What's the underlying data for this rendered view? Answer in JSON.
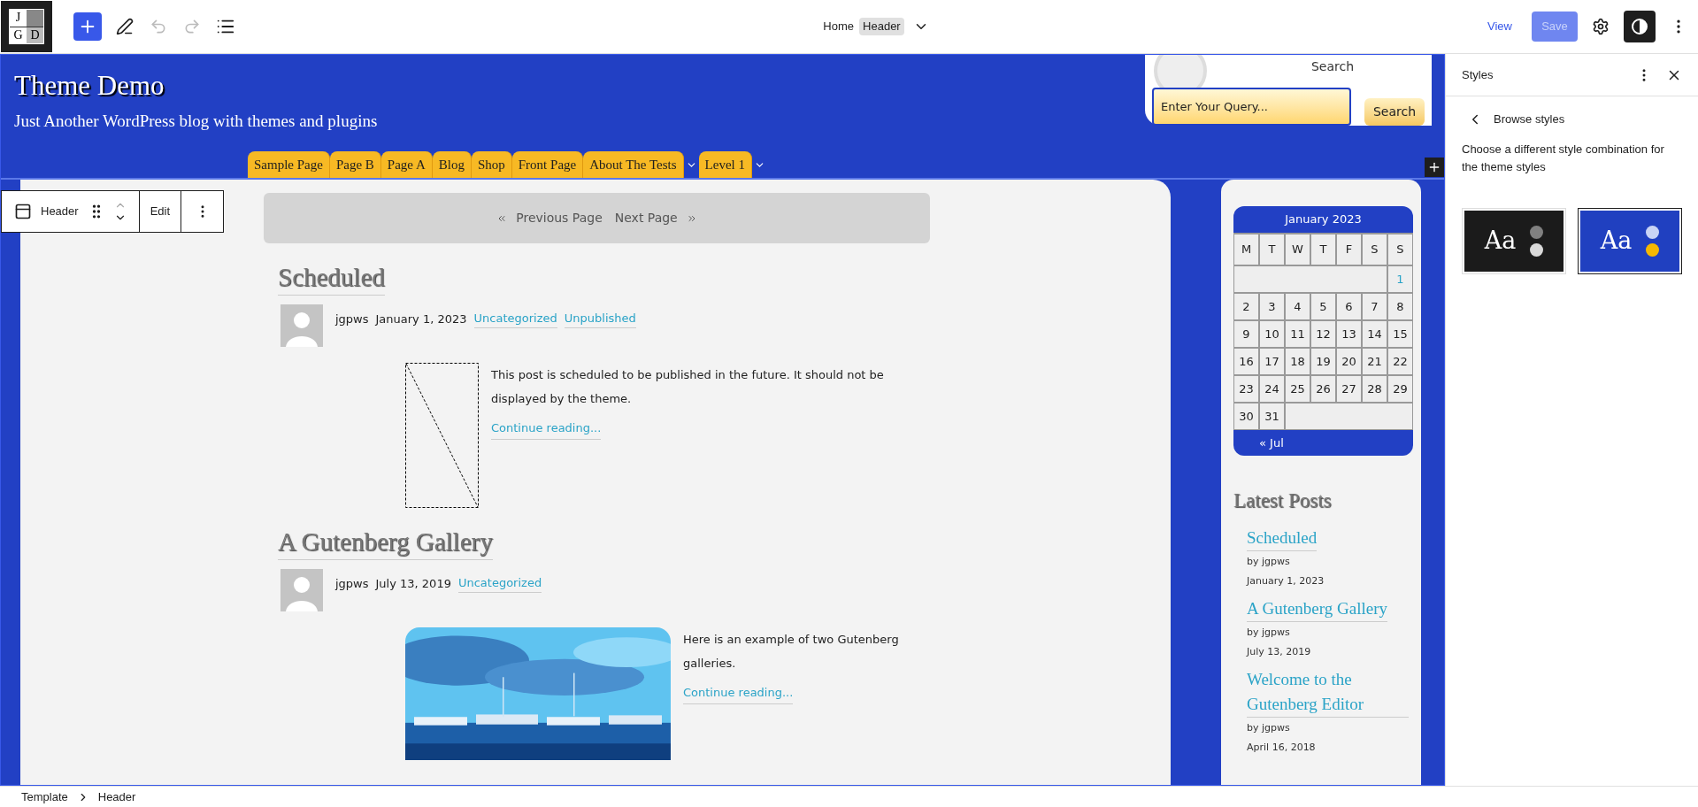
{
  "top_bar": {
    "logo_letters": [
      "J",
      "G",
      "D"
    ],
    "title": "Home",
    "badge": "Header",
    "view": "View",
    "save": {
      "label": "Save",
      "disabled": true
    },
    "style_toggle": {
      "selected": true
    }
  },
  "header": {
    "site_title": "Theme Demo",
    "tagline": "Just Another WordPress blog with themes and plugins",
    "search": {
      "label": "Search",
      "placeholder": "Enter Your Query...",
      "button": "Search"
    },
    "nav": [
      {
        "label": "Sample Page",
        "submenu": false
      },
      {
        "label": "Page B",
        "submenu": false
      },
      {
        "label": "Page A",
        "submenu": false
      },
      {
        "label": "Blog",
        "submenu": false
      },
      {
        "label": "Shop",
        "submenu": false
      },
      {
        "label": "Front Page",
        "submenu": false
      },
      {
        "label": "About The Tests",
        "submenu": true
      },
      {
        "label": "Level 1",
        "submenu": true
      }
    ]
  },
  "block_toolbar": {
    "label": "Header",
    "edit": "Edit"
  },
  "pagination": {
    "previous": "Previous Page",
    "next": "Next Page"
  },
  "posts": [
    {
      "title": "Scheduled",
      "author": "jgpws",
      "date": "January 1, 2023",
      "categories": [
        "Uncategorized",
        "Unpublished"
      ],
      "excerpt": "This post is scheduled to be published in the future. It should not be displayed by the theme.",
      "more": "Continue reading...",
      "kind": "placeholder"
    },
    {
      "title": "A Gutenberg Gallery",
      "author": "jgpws",
      "date": "July 13, 2019",
      "categories": [
        "Uncategorized"
      ],
      "excerpt": "Here is an example of two Gutenberg galleries.",
      "more": "Continue reading...",
      "kind": "picture"
    }
  ],
  "calendar": {
    "caption": "January 2023",
    "weekdays": [
      "M",
      "T",
      "W",
      "T",
      "F",
      "S",
      "S"
    ],
    "weeks": [
      [
        {
          "day": "1",
          "linked": true
        }
      ],
      [
        {
          "day": "2",
          "linked": false
        },
        {
          "day": "3",
          "linked": false
        },
        {
          "day": "4",
          "linked": false
        },
        {
          "day": "5",
          "linked": false
        },
        {
          "day": "6",
          "linked": false
        },
        {
          "day": "7",
          "linked": false
        },
        {
          "day": "8",
          "linked": false
        }
      ],
      [
        {
          "day": "9",
          "linked": false
        },
        {
          "day": "10",
          "linked": false
        },
        {
          "day": "11",
          "linked": false
        },
        {
          "day": "12",
          "linked": false
        },
        {
          "day": "13",
          "linked": false
        },
        {
          "day": "14",
          "linked": false
        },
        {
          "day": "15",
          "linked": false
        }
      ],
      [
        {
          "day": "16",
          "linked": false
        },
        {
          "day": "17",
          "linked": false
        },
        {
          "day": "18",
          "linked": false
        },
        {
          "day": "19",
          "linked": false
        },
        {
          "day": "20",
          "linked": false
        },
        {
          "day": "21",
          "linked": false
        },
        {
          "day": "22",
          "linked": false
        }
      ],
      [
        {
          "day": "23",
          "linked": false
        },
        {
          "day": "24",
          "linked": false
        },
        {
          "day": "25",
          "linked": false
        },
        {
          "day": "26",
          "linked": false
        },
        {
          "day": "27",
          "linked": false
        },
        {
          "day": "28",
          "linked": false
        },
        {
          "day": "29",
          "linked": false
        }
      ],
      [
        {
          "day": "30",
          "linked": false
        },
        {
          "day": "31",
          "linked": false
        }
      ]
    ],
    "previous": "« Jul"
  },
  "latest_posts": {
    "title": "Latest Posts",
    "items": [
      {
        "title": "Scheduled",
        "by": "by jgpws",
        "date": "January 1, 2023"
      },
      {
        "title": "A Gutenberg Gallery",
        "by": "by jgpws",
        "date": "July 13, 2019"
      },
      {
        "title": "Welcome to the Gutenberg Editor",
        "by": "by jgpws",
        "date": "April 16, 2018"
      }
    ]
  },
  "styles_panel": {
    "title": "Styles",
    "back": "Browse styles",
    "description": "Choose a different style combination for the theme styles",
    "variations": [
      {
        "sample": "Aa",
        "selected": false,
        "color": "#1b1b1b",
        "dots": [
          {
            "color": "#808080"
          },
          {
            "color": "#d9d9d9"
          }
        ]
      },
      {
        "sample": "Aa",
        "selected": true,
        "color": "#2040c0",
        "dots": [
          {
            "color": "#c9d4f5"
          },
          {
            "color": "#f5b800"
          }
        ]
      }
    ]
  },
  "breadcrumb": [
    "Template",
    "Header"
  ]
}
